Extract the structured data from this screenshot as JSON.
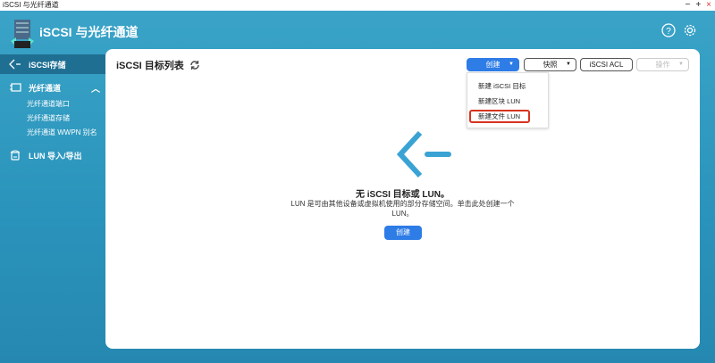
{
  "window": {
    "title": "iSCSI 与光纤通道",
    "controls": {
      "minimize": "−",
      "maximize": "+",
      "close": "×"
    }
  },
  "header": {
    "title": "iSCSI 与光纤通道",
    "icons": [
      "help-icon",
      "gear-icon"
    ]
  },
  "sidebar": {
    "items": [
      {
        "label": "iSCSI存储",
        "icon": "iscsi-icon",
        "active": true
      },
      {
        "label": "光纤通道",
        "icon": "fibre-channel-icon",
        "expanded": true,
        "children": [
          "光纤通道端口",
          "光纤通道存储",
          "光纤通道 WWPN 别名"
        ]
      },
      {
        "label": "LUN 导入/导出",
        "icon": "lun-import-export-icon"
      }
    ]
  },
  "main": {
    "title": "iSCSI 目标列表",
    "toolbar": {
      "create": "创建",
      "snapshot": "快照",
      "acl": "iSCSI ACL",
      "action": "操作"
    },
    "create_menu": [
      "新建 iSCSI 目标",
      "新建区块 LUN",
      "新建文件 LUN"
    ],
    "empty": {
      "title": "无 iSCSI 目标或 LUN。",
      "desc_line1": "LUN 是可由其他设备或虚拟机使用的部分存储空间。单击此处创建一个",
      "desc_line2": "LUN。",
      "button": "创建"
    }
  },
  "colors": {
    "accent": "#2e7ce6",
    "brand": "#2f9cc2",
    "highlight": "#d8331f"
  }
}
